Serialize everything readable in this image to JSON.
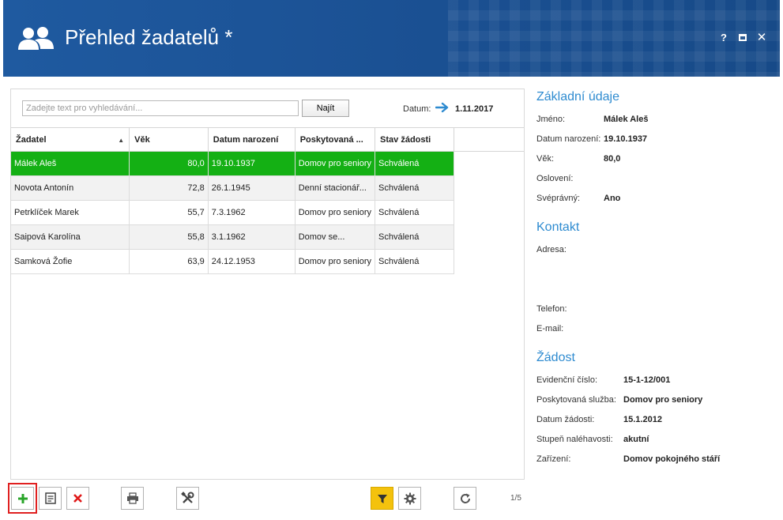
{
  "header": {
    "title": "Přehled žadatelů *",
    "help_label": "?",
    "close_label": "✕"
  },
  "search": {
    "placeholder": "Zadejte text pro vyhledávání...",
    "value": "",
    "find_label": "Najít"
  },
  "date": {
    "label": "Datum:",
    "value": "1.11.2017"
  },
  "table": {
    "columns": [
      "Žadatel",
      "Věk",
      "Datum narození",
      "Poskytovaná ...",
      "Stav žádosti"
    ],
    "rows": [
      {
        "name": "Málek Aleš",
        "age": "80,0",
        "dob": "19.10.1937",
        "service": "Domov pro seniory",
        "status": "Schválená"
      },
      {
        "name": "Novota Antonín",
        "age": "72,8",
        "dob": "26.1.1945",
        "service": "Denní stacionář...",
        "status": "Schválená"
      },
      {
        "name": "Petrklíček Marek",
        "age": "55,7",
        "dob": "7.3.1962",
        "service": "Domov pro seniory",
        "status": "Schválená"
      },
      {
        "name": "Saipová Karolína",
        "age": "55,8",
        "dob": "3.1.1962",
        "service": "Domov se...",
        "status": "Schválená"
      },
      {
        "name": "Samková Žofie",
        "age": "63,9",
        "dob": "24.12.1953",
        "service": "Domov pro seniory",
        "status": "Schválená"
      }
    ]
  },
  "toolbar": {
    "page": "1/5"
  },
  "details": {
    "basic_title": "Základní údaje",
    "name_label": "Jméno:",
    "name_value": "Málek Aleš",
    "dob_label": "Datum narození:",
    "dob_value": "19.10.1937",
    "age_label": "Věk:",
    "age_value": "80,0",
    "salutation_label": "Oslovení:",
    "competent_label": "Svéprávný:",
    "competent_value": "Ano",
    "contact_title": "Kontakt",
    "address_label": "Adresa:",
    "phone_label": "Telefon:",
    "email_label": "E-mail:",
    "request_title": "Žádost",
    "reg_label": "Evidenční číslo:",
    "reg_value": "15-1-12/001",
    "service_label": "Poskytovaná služba:",
    "service_value": "Domov pro seniory",
    "req_date_label": "Datum žádosti:",
    "req_date_value": "15.1.2012",
    "urgency_label": "Stupeň naléhavosti:",
    "urgency_value": "akutní",
    "facility_label": "Zařízení:",
    "facility_value": "Domov pokojného stáří"
  },
  "colors": {
    "header": "#1a4f91",
    "selected_row": "#14b014",
    "section_title": "#2e8bd0",
    "filter_active": "#f4c20d"
  }
}
